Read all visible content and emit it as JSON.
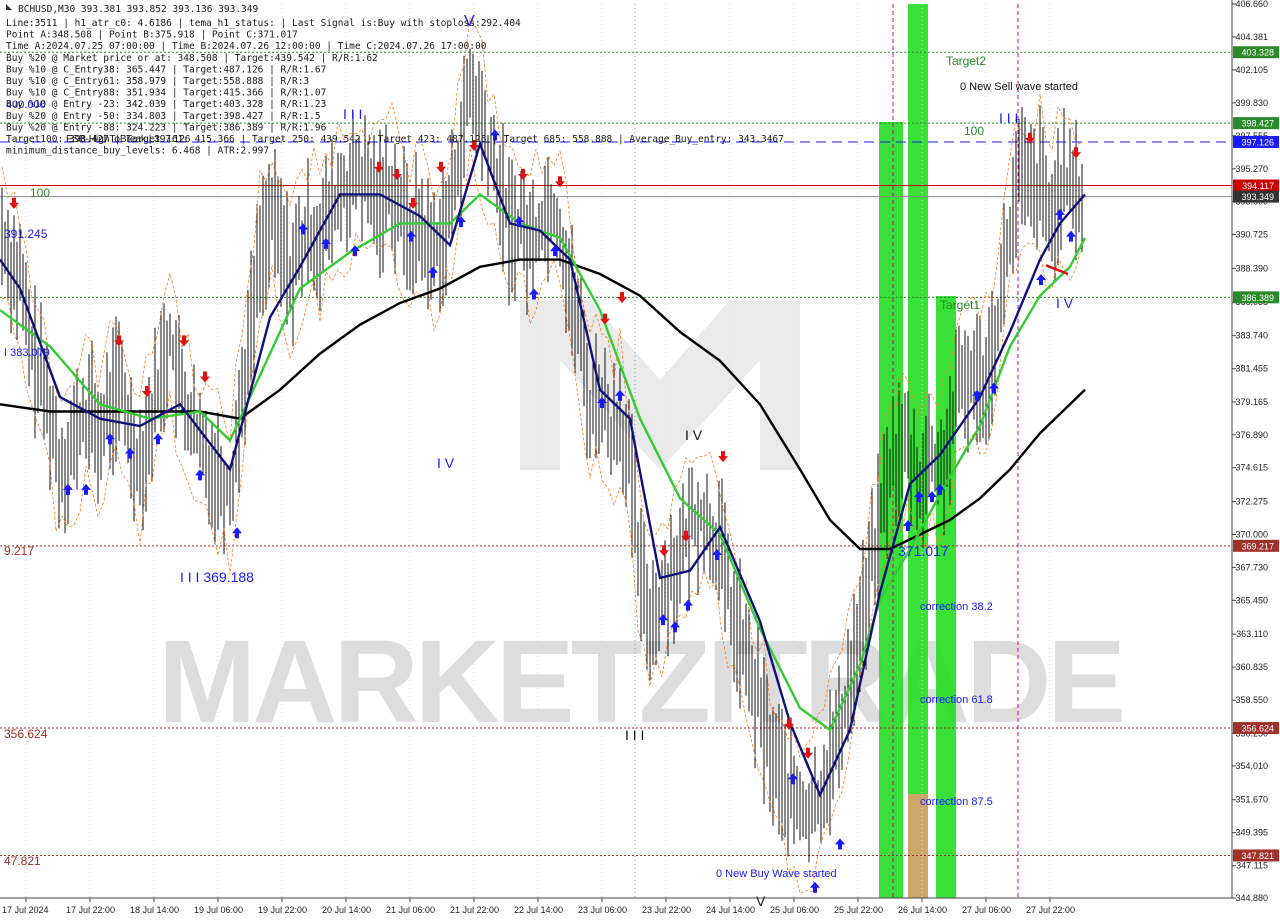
{
  "info": {
    "symbol_line": "BCHUSD,M30  393.381 393.852 393.136 393.349",
    "lines": [
      "Line:3511 | h1_atr_c0: 4.6186 | tema_h1_status: | Last Signal is:Buy with stoploss:292.404",
      "Point A:348.508 | Point B:375.918 | Point C:371.017",
      "Time A:2024.07.25 07:00:00 | Time B:2024.07.26 12:00:00 | Time C:2024.07.26 17:00:00",
      "Buy %20 @ Market price or at: 348.508 | Target:439.542 | R/R:1.62",
      "Buy %10 @ C_Entry38: 365.447 | Target:487.126 | R/R:1.67",
      "Buy %10 @ C_Entry61: 358.979 | Target:558.888 | R/R:3",
      "Buy %10 @ C_Entry88: 351.934 | Target:415.366 | R/R:1.07",
      "Buy %10 @ Entry -23: 342.039 | Target:403.328 | R/R:1.23",
      "Buy %20 @ Entry -50: 334.803 | Target:398.427 | R/R:1.5",
      "Buy %20 @ Entry -88: 324.223 | Target:386.389 | R/R:1.96",
      "Target100: 398.427 | Target 161: 415.366 | Target 250: 439.542 | Target 423: 487.126 | Target 685: 558.888 | Average_Buy_entry: 343.3467",
      "minimum_distance_buy_levels: 6.468 | ATR:2.997"
    ]
  },
  "watermark": "MARKETZITRADE",
  "colors": {
    "bull_bar": "#111111",
    "green_ma": "#33cc33",
    "navy_ma": "#10107a",
    "black_ma": "#000000",
    "red_line": "#cc0000",
    "blue_dash": "#1a1aff",
    "green_dotted": "#2a8a2a",
    "brown_dotted": "#a0302a",
    "zone_green": "#22dd22",
    "zone_orange": "#e0a070",
    "magenta_vline": "#cc00aa"
  },
  "price_axis": {
    "labels": [
      "406.660",
      "404.381",
      "402.105",
      "399.830",
      "397.555",
      "395.270",
      "393.000",
      "390.725",
      "388.390",
      "386.055",
      "383.740",
      "381.455",
      "379.165",
      "376.890",
      "374.615",
      "372.275",
      "370.000",
      "367.730",
      "365.450",
      "363.110",
      "360.835",
      "358.550",
      "356.250",
      "354.010",
      "351.670",
      "349.395",
      "347.115",
      "344.880"
    ],
    "tags": [
      {
        "text": "403.328",
        "color": "#2a8a2a",
        "price": 403.328
      },
      {
        "text": "398.427",
        "color": "#2a8a2a",
        "price": 398.427
      },
      {
        "text": "397.126",
        "color": "#1a1aff",
        "price": 397.126
      },
      {
        "text": "394.117",
        "color": "#cc0000",
        "price": 394.117
      },
      {
        "text": "393.349",
        "color": "#333333",
        "price": 393.349
      },
      {
        "text": "386.389",
        "color": "#2a8a2a",
        "price": 386.389
      },
      {
        "text": "369.217",
        "color": "#a0302a",
        "price": 369.217
      },
      {
        "text": "356.624",
        "color": "#a0302a",
        "price": 356.624
      },
      {
        "text": "347.821",
        "color": "#a0302a",
        "price": 347.821
      }
    ]
  },
  "time_axis": {
    "labels": [
      "17 Jul 2024",
      "17 Jul 22:00",
      "18 Jul 14:00",
      "19 Jul 06:00",
      "19 Jul 22:00",
      "20 Jul 14:00",
      "21 Jul 06:00",
      "21 Jul 22:00",
      "22 Jul 14:00",
      "23 Jul 06:00",
      "23 Jul 22:00",
      "24 Jul 14:00",
      "25 Jul 06:00",
      "25 Jul 22:00",
      "26 Jul 14:00",
      "27 Jul 06:00",
      "27 Jul 22:00"
    ]
  },
  "annotations": {
    "target2": "Target2",
    "target1": "Target1",
    "new_sell": "0 New Sell wave started",
    "new_buy": "0 New Buy Wave started",
    "hundred_right": "100",
    "hundred_left": "100",
    "wave_iii_top": "I I I",
    "wave_iii_right": "I I I",
    "wave_iv_left": "I V",
    "wave_iv_mid": "I V",
    "wave_iv_right": "I V",
    "wave_v_top": "V",
    "wave_v_bottom": "V",
    "wave_iii_bottom": "I I I",
    "wave_iii_369": "I I I 369.188",
    "left_391": "391.245",
    "left_383": "I 383.079",
    "left_369": "9.217",
    "left_356": "356.624",
    "left_347": "47.821",
    "left_400": "400.000",
    "fsb_label": "FSB-HighToBreak | 397.126",
    "c_label": "371.017",
    "corr_382": "correction 38.2",
    "corr_618": "correction 61.8",
    "corr_875": "correction 87.5"
  },
  "chart_data": {
    "type": "candlestick",
    "title": "BCHUSD,M30",
    "ohlc_last": {
      "open": 393.381,
      "high": 393.852,
      "low": 393.136,
      "close": 393.349
    },
    "ylim": [
      344.88,
      406.66
    ],
    "levels": [
      {
        "name": "Target2",
        "price": 403.328,
        "style": "green-dotted"
      },
      {
        "name": "100",
        "price": 398.427,
        "style": "green-dotted"
      },
      {
        "name": "FSB-HighToBreak",
        "price": 397.126,
        "style": "blue-dashed"
      },
      {
        "name": "current",
        "price": 394.117,
        "style": "red-solid"
      },
      {
        "name": "Target1",
        "price": 386.389,
        "style": "green-dotted"
      },
      {
        "price": 369.217,
        "style": "brown-dotted"
      },
      {
        "price": 356.624,
        "style": "brown-dotted"
      },
      {
        "price": 347.821,
        "style": "brown-dotted"
      }
    ],
    "price_path": [
      [
        0,
        391.2
      ],
      [
        10,
        389.0
      ],
      [
        20,
        387.5
      ],
      [
        30,
        383.0
      ],
      [
        40,
        381.0
      ],
      [
        50,
        378.5
      ],
      [
        60,
        374.5
      ],
      [
        70,
        376.0
      ],
      [
        80,
        377.5
      ],
      [
        90,
        378.5
      ],
      [
        100,
        376.5
      ],
      [
        110,
        379.0
      ],
      [
        120,
        380.5
      ],
      [
        130,
        377.0
      ],
      [
        140,
        375.0
      ],
      [
        150,
        377.5
      ],
      [
        160,
        381.0
      ],
      [
        170,
        383.5
      ],
      [
        180,
        380.0
      ],
      [
        190,
        378.0
      ],
      [
        200,
        376.0
      ],
      [
        210,
        375.0
      ],
      [
        220,
        374.0
      ],
      [
        230,
        373.0
      ],
      [
        240,
        378.5
      ],
      [
        250,
        384.0
      ],
      [
        260,
        389.5
      ],
      [
        270,
        392.0
      ],
      [
        280,
        390.5
      ],
      [
        290,
        388.0
      ],
      [
        300,
        389.5
      ],
      [
        310,
        391.0
      ],
      [
        320,
        390.5
      ],
      [
        330,
        392.0
      ],
      [
        340,
        393.5
      ],
      [
        350,
        394.0
      ],
      [
        360,
        394.8
      ],
      [
        370,
        393.5
      ],
      [
        380,
        393.0
      ],
      [
        390,
        394.2
      ],
      [
        400,
        392.5
      ],
      [
        410,
        390.5
      ],
      [
        420,
        391.5
      ],
      [
        430,
        389.5
      ],
      [
        440,
        390.5
      ],
      [
        450,
        392.0
      ],
      [
        460,
        397.0
      ],
      [
        470,
        400.5
      ],
      [
        480,
        399.0
      ],
      [
        490,
        396.0
      ],
      [
        500,
        394.0
      ],
      [
        510,
        391.0
      ],
      [
        520,
        391.5
      ],
      [
        530,
        390.0
      ],
      [
        540,
        391.5
      ],
      [
        550,
        393.0
      ],
      [
        560,
        391.0
      ],
      [
        570,
        387.0
      ],
      [
        580,
        384.0
      ],
      [
        590,
        378.5
      ],
      [
        600,
        380.0
      ],
      [
        610,
        377.0
      ],
      [
        620,
        378.5
      ],
      [
        630,
        374.5
      ],
      [
        640,
        367.0
      ],
      [
        650,
        364.5
      ],
      [
        660,
        365.0
      ],
      [
        670,
        367.5
      ],
      [
        680,
        368.0
      ],
      [
        690,
        370.5
      ],
      [
        700,
        371.5
      ],
      [
        710,
        370.0
      ],
      [
        720,
        369.5
      ],
      [
        730,
        365.0
      ],
      [
        740,
        363.0
      ],
      [
        750,
        360.0
      ],
      [
        760,
        358.0
      ],
      [
        770,
        355.0
      ],
      [
        780,
        353.5
      ],
      [
        790,
        352.0
      ],
      [
        800,
        351.0
      ],
      [
        810,
        350.5
      ],
      [
        820,
        352.0
      ],
      [
        830,
        354.5
      ],
      [
        840,
        356.0
      ],
      [
        850,
        360.5
      ],
      [
        860,
        363.5
      ],
      [
        870,
        367.0
      ],
      [
        880,
        371.0
      ],
      [
        890,
        374.5
      ],
      [
        900,
        376.0
      ],
      [
        910,
        375.5
      ],
      [
        920,
        373.5
      ],
      [
        930,
        375.5
      ],
      [
        940,
        374.0
      ],
      [
        950,
        377.0
      ],
      [
        960,
        380.0
      ],
      [
        970,
        381.0
      ],
      [
        980,
        380.5
      ],
      [
        990,
        382.0
      ],
      [
        1000,
        386.0
      ],
      [
        1010,
        391.0
      ],
      [
        1020,
        395.0
      ],
      [
        1030,
        393.5
      ],
      [
        1040,
        394.5
      ],
      [
        1050,
        391.0
      ],
      [
        1060,
        394.5
      ],
      [
        1070,
        393.5
      ],
      [
        1080,
        393.3
      ]
    ],
    "ma_green": [
      [
        0,
        385.5
      ],
      [
        50,
        383.0
      ],
      [
        100,
        379.0
      ],
      [
        150,
        378.0
      ],
      [
        200,
        378.5
      ],
      [
        230,
        376.5
      ],
      [
        260,
        381.0
      ],
      [
        300,
        387.0
      ],
      [
        350,
        389.5
      ],
      [
        400,
        391.5
      ],
      [
        450,
        391.5
      ],
      [
        480,
        393.5
      ],
      [
        520,
        391.5
      ],
      [
        560,
        390.5
      ],
      [
        600,
        385.5
      ],
      [
        640,
        378.0
      ],
      [
        680,
        372.5
      ],
      [
        720,
        370.0
      ],
      [
        760,
        363.5
      ],
      [
        800,
        358.0
      ],
      [
        830,
        356.5
      ],
      [
        860,
        361.0
      ],
      [
        880,
        365.5
      ],
      [
        910,
        369.0
      ],
      [
        950,
        374.0
      ],
      [
        980,
        377.5
      ],
      [
        1010,
        383.0
      ],
      [
        1040,
        386.5
      ],
      [
        1070,
        388.5
      ],
      [
        1085,
        390.5
      ]
    ],
    "ma_navy": [
      [
        0,
        389.0
      ],
      [
        20,
        387.0
      ],
      [
        60,
        379.5
      ],
      [
        100,
        378.0
      ],
      [
        140,
        377.5
      ],
      [
        180,
        379.0
      ],
      [
        230,
        374.5
      ],
      [
        270,
        385.0
      ],
      [
        300,
        388.5
      ],
      [
        340,
        393.5
      ],
      [
        380,
        393.5
      ],
      [
        420,
        392.0
      ],
      [
        450,
        390.0
      ],
      [
        480,
        397.0
      ],
      [
        510,
        391.5
      ],
      [
        540,
        391.0
      ],
      [
        570,
        389.0
      ],
      [
        600,
        380.0
      ],
      [
        630,
        378.0
      ],
      [
        660,
        367.0
      ],
      [
        690,
        367.5
      ],
      [
        720,
        370.5
      ],
      [
        760,
        364.0
      ],
      [
        790,
        357.0
      ],
      [
        820,
        352.0
      ],
      [
        850,
        356.5
      ],
      [
        880,
        366.0
      ],
      [
        910,
        373.5
      ],
      [
        940,
        375.5
      ],
      [
        980,
        379.5
      ],
      [
        1010,
        384.0
      ],
      [
        1040,
        389.0
      ],
      [
        1060,
        391.5
      ],
      [
        1085,
        393.5
      ]
    ],
    "ma_black": [
      [
        0,
        379.0
      ],
      [
        50,
        378.5
      ],
      [
        100,
        378.5
      ],
      [
        150,
        378.5
      ],
      [
        200,
        378.5
      ],
      [
        240,
        378.0
      ],
      [
        280,
        380.0
      ],
      [
        320,
        382.5
      ],
      [
        360,
        384.5
      ],
      [
        400,
        386.0
      ],
      [
        440,
        387.0
      ],
      [
        480,
        388.5
      ],
      [
        520,
        389.0
      ],
      [
        560,
        389.0
      ],
      [
        600,
        388.0
      ],
      [
        640,
        386.5
      ],
      [
        680,
        384.0
      ],
      [
        720,
        382.0
      ],
      [
        760,
        379.0
      ],
      [
        800,
        374.5
      ],
      [
        830,
        371.0
      ],
      [
        860,
        369.0
      ],
      [
        890,
        369.0
      ],
      [
        920,
        370.0
      ],
      [
        950,
        371.0
      ],
      [
        980,
        372.5
      ],
      [
        1010,
        374.5
      ],
      [
        1040,
        377.0
      ],
      [
        1085,
        380.0
      ]
    ],
    "arrows_up": [
      [
        68,
        373.5
      ],
      [
        86,
        373.5
      ],
      [
        110,
        377.0
      ],
      [
        130,
        376.0
      ],
      [
        158,
        377.0
      ],
      [
        200,
        374.5
      ],
      [
        237,
        370.5
      ],
      [
        303,
        391.5
      ],
      [
        326,
        390.5
      ],
      [
        355,
        390.0
      ],
      [
        411,
        391.0
      ],
      [
        433,
        388.5
      ],
      [
        461,
        392.0
      ],
      [
        495,
        398.0
      ],
      [
        519,
        392.0
      ],
      [
        534,
        387.0
      ],
      [
        555,
        390.0
      ],
      [
        602,
        379.5
      ],
      [
        620,
        380.0
      ],
      [
        663,
        364.5
      ],
      [
        675,
        364.0
      ],
      [
        688,
        365.5
      ],
      [
        717,
        369.0
      ],
      [
        793,
        353.5
      ],
      [
        815,
        346.0
      ],
      [
        840,
        349.0
      ],
      [
        908,
        371.0
      ],
      [
        919,
        373.0
      ],
      [
        932,
        373.0
      ],
      [
        940,
        373.5
      ],
      [
        977,
        380.0
      ],
      [
        994,
        380.5
      ],
      [
        1041,
        388.0
      ],
      [
        1060,
        392.5
      ],
      [
        1071,
        391.0
      ]
    ],
    "arrows_down": [
      [
        14,
        392.5
      ],
      [
        119,
        383.0
      ],
      [
        147,
        379.5
      ],
      [
        184,
        383.0
      ],
      [
        205,
        380.5
      ],
      [
        379,
        395.0
      ],
      [
        397,
        394.5
      ],
      [
        413,
        392.5
      ],
      [
        441,
        395.0
      ],
      [
        474,
        396.5
      ],
      [
        523,
        394.5
      ],
      [
        560,
        394.0
      ],
      [
        605,
        384.5
      ],
      [
        622,
        386.0
      ],
      [
        664,
        368.5
      ],
      [
        686,
        369.5
      ],
      [
        723,
        375.0
      ],
      [
        789,
        356.5
      ],
      [
        808,
        354.5
      ],
      [
        1030,
        397.0
      ],
      [
        1076,
        396.0
      ]
    ]
  }
}
